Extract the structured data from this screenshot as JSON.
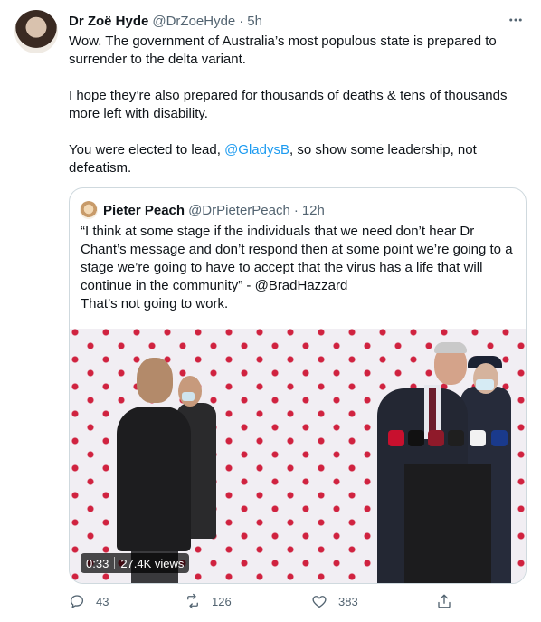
{
  "tweet": {
    "display_name": "Dr Zoë Hyde",
    "handle": "@DrZoeHyde",
    "separator": "·",
    "time": "5h",
    "text_p1": "Wow. The government of Australia’s most populous state is prepared to surrender to the delta variant.",
    "text_p2": "I hope they’re also prepared for thousands of deaths & tens of thousands more left with disability.",
    "text_p3_before": "You were elected to lead, ",
    "text_p3_mention": "@GladysB",
    "text_p3_after": ", so show some leadership, not defeatism."
  },
  "quote": {
    "display_name": "Pieter Peach",
    "handle": "@DrPieterPeach",
    "separator": "·",
    "time": "12h",
    "text_line1": "“I think at some stage if the individuals that we need don’t hear Dr Chant’s message and don’t respond then at some point we’re going to a stage we’re going to have to accept that the virus has a life that will continue in the community” - @BradHazzard",
    "text_line2": "That’s not going to work.",
    "video": {
      "duration": "0:33",
      "views": "27.4K views"
    }
  },
  "actions": {
    "replies": "43",
    "retweets": "126",
    "likes": "383"
  },
  "icons": {
    "more": "more-horizontal-icon",
    "reply": "reply-icon",
    "retweet": "retweet-icon",
    "like": "heart-icon",
    "share": "share-icon"
  },
  "colors": {
    "accent": "#1d9bf0",
    "secondary_text": "#536471",
    "border": "#cfd9de"
  }
}
